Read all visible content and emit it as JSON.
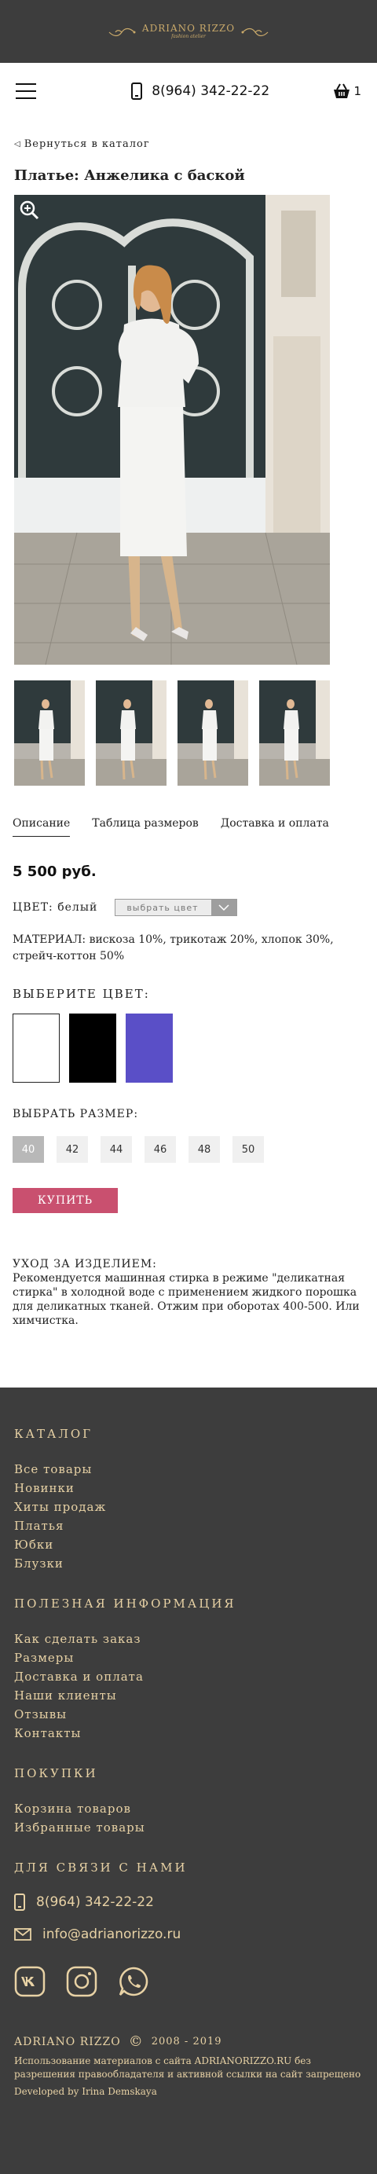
{
  "brand": {
    "name": "ADRIANO RIZZO",
    "tagline": "fashion atelier"
  },
  "header": {
    "phone": "8(964) 342-22-22",
    "cart_count": "1"
  },
  "nav": {
    "back_label": "Вернуться в каталог"
  },
  "product": {
    "title": "Платье: Анжелика с баской",
    "tabs": [
      {
        "label": "Описание",
        "active": true
      },
      {
        "label": "Таблица размеров",
        "active": false
      },
      {
        "label": "Доставка и оплата",
        "active": false
      }
    ],
    "price": "5 500 руб.",
    "color_label": "ЦВЕТ: белый",
    "color_select_placeholder": "выбрать цвет",
    "material": "МАТЕРИАЛ: вискоза 10%, трикотаж 20%, хлопок 30%, стрейч-коттон 50%",
    "choose_color_title": "ВЫБЕРИТЕ ЦВЕТ:",
    "swatches": [
      {
        "name": "white",
        "color": "#ffffff"
      },
      {
        "name": "black",
        "color": "#000000"
      },
      {
        "name": "violet",
        "color": "#5a4fc7"
      }
    ],
    "choose_size_title": "ВЫБРАТЬ РАЗМЕР:",
    "sizes": [
      "40",
      "42",
      "44",
      "46",
      "48",
      "50"
    ],
    "selected_size": "40",
    "buy_label": "КУПИТЬ",
    "care_title": "УХОД ЗА ИЗДЕЛИЕМ:",
    "care_text": "Рекомендуется машинная стирка в режиме \"деликатная стирка\" в холодной воде с применением жидкого порошка для деликатных тканей. Отжим при оборотах 400-500. Или химчистка."
  },
  "footer": {
    "catalog_title": "КАТАЛОГ",
    "catalog_items": [
      "Все товары",
      "Новинки",
      "Хиты продаж",
      "Платья",
      "Юбки",
      "Блузки"
    ],
    "info_title": "ПОЛЕЗНАЯ ИНФОРМАЦИЯ",
    "info_items": [
      "Как сделать заказ",
      "Размеры",
      "Доставка и оплата",
      "Наши клиенты",
      "Отзывы",
      "Контакты"
    ],
    "shopping_title": "ПОКУПКИ",
    "shopping_items": [
      "Корзина товаров",
      "Избранные товары"
    ],
    "contact_title": "ДЛЯ СВЯЗИ С НАМИ",
    "phone": "8(964) 342-22-22",
    "email": "info@adrianorizzo.ru",
    "copyright_name": "ADRIANO RIZZO",
    "copyright_symbol": "©",
    "copyright_years": "2008 - 2019",
    "notice": "Использование материалов с сайта ADRIANORIZZO.RU без разрешения правообладателя и активной ссылки на сайт запрещено",
    "developer": "Developed by Irina Demskaya"
  },
  "colors": {
    "dark_bg": "#3d3d3d",
    "gold": "#e8d2a5",
    "buy": "#c9506f"
  }
}
